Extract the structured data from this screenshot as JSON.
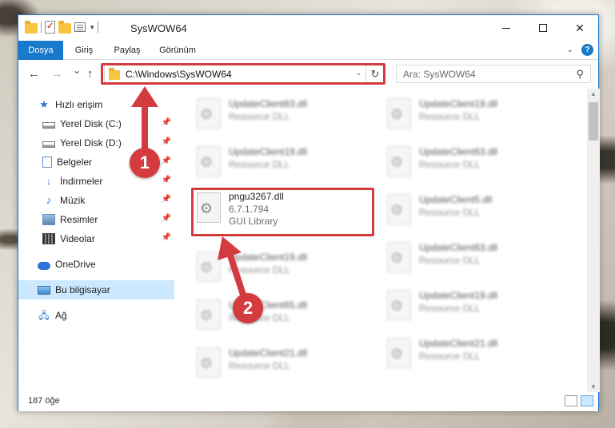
{
  "window": {
    "title": "SysWOW64",
    "controls": {
      "minimize": "",
      "maximize": "",
      "close": "✕"
    }
  },
  "ribbon": {
    "tabs": [
      "Dosya",
      "Giriş",
      "Paylaş",
      "Görünüm"
    ],
    "help": "?"
  },
  "nav": {
    "back": "←",
    "forward": "→",
    "recent": "⌄",
    "up": "↑",
    "address": "C:\\Windows\\SysWOW64",
    "refresh": "↻",
    "search_placeholder": "Ara: SysWOW64",
    "search_icon": "⚲"
  },
  "sidebar": {
    "items": [
      {
        "label": "Hızlı erişim",
        "icon": "star-icon",
        "pinned": false
      },
      {
        "label": "Yerel Disk (C:)",
        "icon": "disk-icon",
        "pinned": true
      },
      {
        "label": "Yerel Disk (D:)",
        "icon": "disk-icon",
        "pinned": true
      },
      {
        "label": "Belgeler",
        "icon": "documents-icon",
        "pinned": true
      },
      {
        "label": "İndirmeler",
        "icon": "download-icon",
        "pinned": true
      },
      {
        "label": "Müzik",
        "icon": "music-icon",
        "pinned": true
      },
      {
        "label": "Resimler",
        "icon": "pictures-icon",
        "pinned": true
      },
      {
        "label": "Videolar",
        "icon": "videos-icon",
        "pinned": true
      },
      {
        "label": "OneDrive",
        "icon": "cloud-icon",
        "pinned": false
      },
      {
        "label": "Bu bilgisayar",
        "icon": "computer-icon",
        "pinned": false,
        "selected": true
      },
      {
        "label": "Ağ",
        "icon": "network-icon",
        "pinned": false
      }
    ]
  },
  "files": {
    "left": [
      {
        "name": "UpdateClient63.dll",
        "meta1": "Resource DLL",
        "meta2": "",
        "blurred": true
      },
      {
        "name": "UpdateClient19.dll",
        "meta1": "Resource DLL",
        "meta2": "",
        "blurred": true
      },
      {
        "name": "pngu3267.dll",
        "meta1": "6.7.1.794",
        "meta2": "GUI Library",
        "blurred": false
      },
      {
        "name": "UpdateClient19.dll",
        "meta1": "Resource DLL",
        "meta2": "",
        "blurred": true
      },
      {
        "name": "UpdateClient65.dll",
        "meta1": "Resource DLL",
        "meta2": "",
        "blurred": true
      },
      {
        "name": "UpdateClient21.dll",
        "meta1": "Resource DLL",
        "meta2": "",
        "blurred": true
      }
    ],
    "right": [
      {
        "name": "UpdateClient19.dll",
        "meta1": "Resource DLL",
        "meta2": "",
        "blurred": true
      },
      {
        "name": "UpdateClient63.dll",
        "meta1": "Resource DLL",
        "meta2": "",
        "blurred": true
      },
      {
        "name": "UpdateClient5.dll",
        "meta1": "Resource DLL",
        "meta2": "",
        "blurred": true
      },
      {
        "name": "UpdateClient63.dll",
        "meta1": "Resource DLL",
        "meta2": "",
        "blurred": true
      },
      {
        "name": "UpdateClient19.dll",
        "meta1": "Resource DLL",
        "meta2": "",
        "blurred": true
      },
      {
        "name": "UpdateClient21.dll",
        "meta1": "Resource DLL",
        "meta2": "",
        "blurred": true
      }
    ]
  },
  "status": {
    "count": "187 öğe"
  },
  "annotations": {
    "step1": "1",
    "step2": "2",
    "color": "#d43b3f"
  }
}
